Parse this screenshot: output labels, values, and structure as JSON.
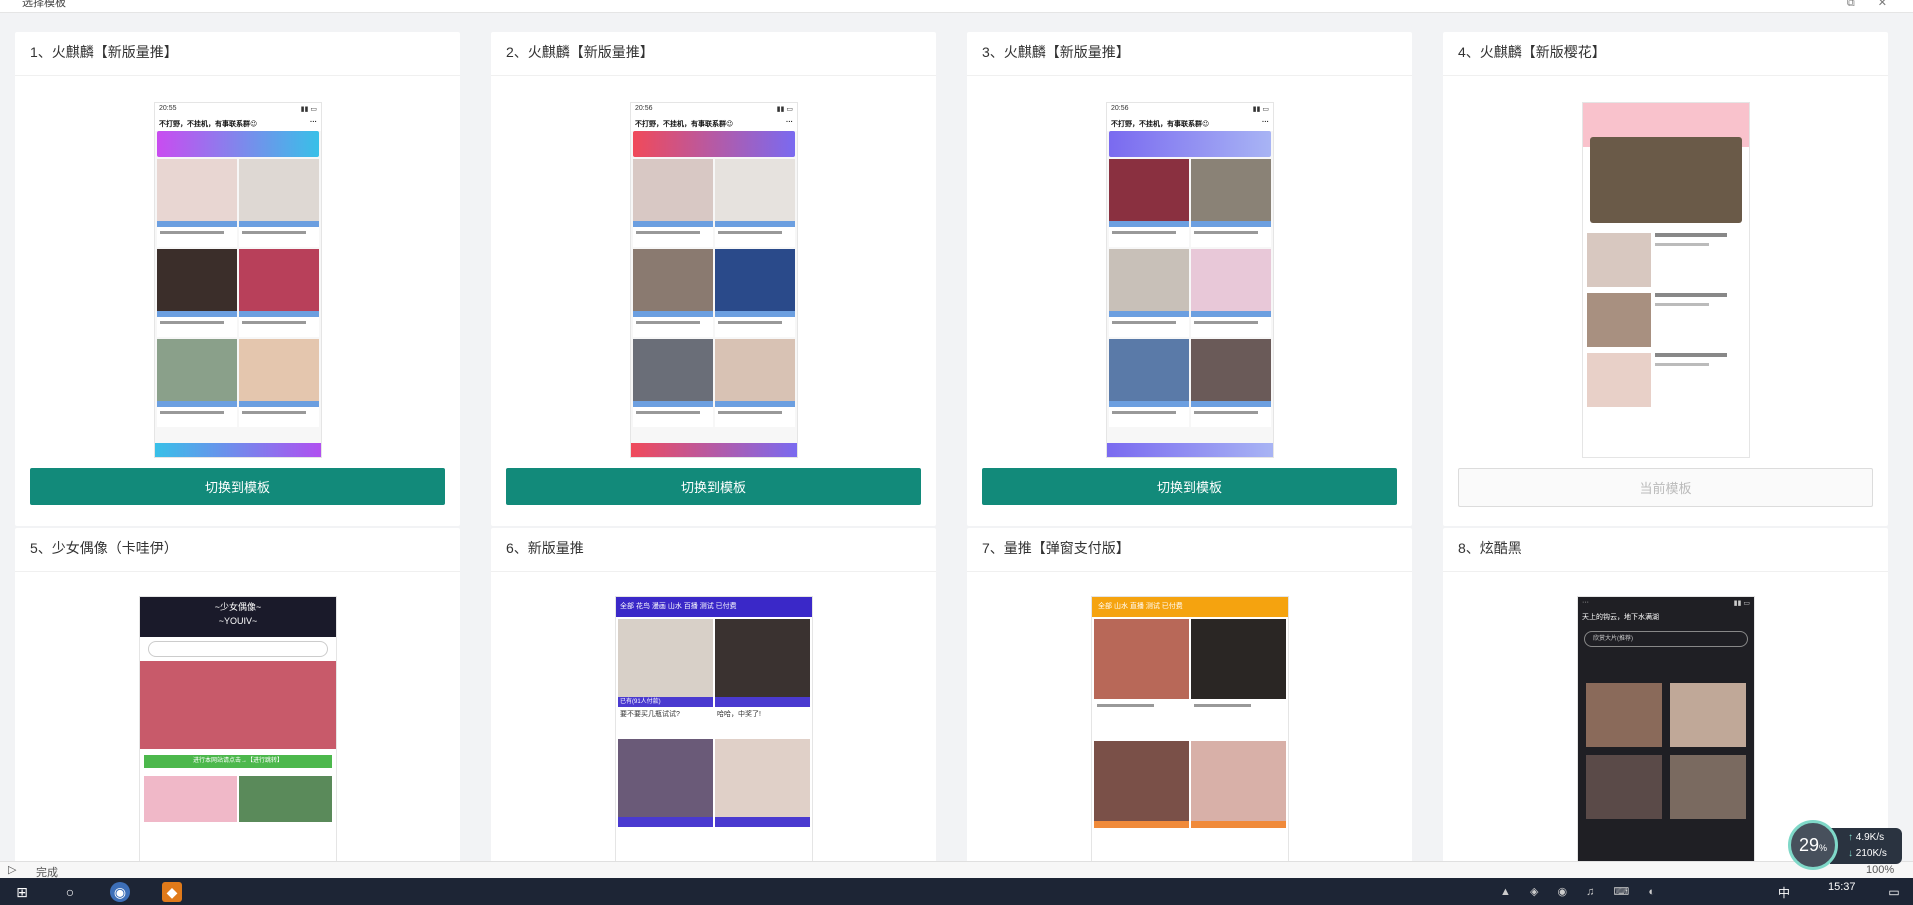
{
  "window": {
    "title": "选择模板"
  },
  "templates": [
    {
      "title": "1、火麒麟【新版量推】",
      "button": "切换到模板"
    },
    {
      "title": "2、火麒麟【新版量推】",
      "button": "切换到模板"
    },
    {
      "title": "3、火麒麟【新版量推】",
      "button": "切换到模板"
    },
    {
      "title": "4、火麒麟【新版樱花】",
      "button": "当前模板"
    },
    {
      "title": "5、少女偶像（卡哇伊）"
    },
    {
      "title": "6、新版量推"
    },
    {
      "title": "7、量推【弹窗支付版】"
    },
    {
      "title": "8、炫酷黑"
    }
  ],
  "previews": {
    "p1": {
      "time": "20:55",
      "head": "不打野，不挂机，有事联系群😉"
    },
    "p2": {
      "time": "20:56",
      "head": "不打野，不挂机，有事联系群😉"
    },
    "p3": {
      "time": "20:56",
      "head": "不打野，不挂机，有事联系群😉"
    },
    "p5": {
      "logo": "~少女偶像~",
      "sub": "~YOUIV~",
      "btn": "进行本网站请点击→【进行跳转】"
    },
    "p6": {
      "tabs": "全部  花鸟  漫画  山水  百播  测试  已付费",
      "cap1": "已有(91人付款)",
      "t1": "要不要买几瓶试试?",
      "t2": "哈哈，中奖了!"
    },
    "p7": {
      "tabs": "全部  山水  直播  测试  已付费"
    },
    "p8": {
      "head": "天上的钩云，地下水满湖",
      "search": "欣赏大片(推荐)"
    }
  },
  "status": {
    "text": "完成",
    "zoom": "100%"
  },
  "netmeter": {
    "pct": "29",
    "up": "4.9K/s",
    "down": "210K/s"
  },
  "taskbar": {
    "time": "15:37",
    "ime": "中"
  }
}
